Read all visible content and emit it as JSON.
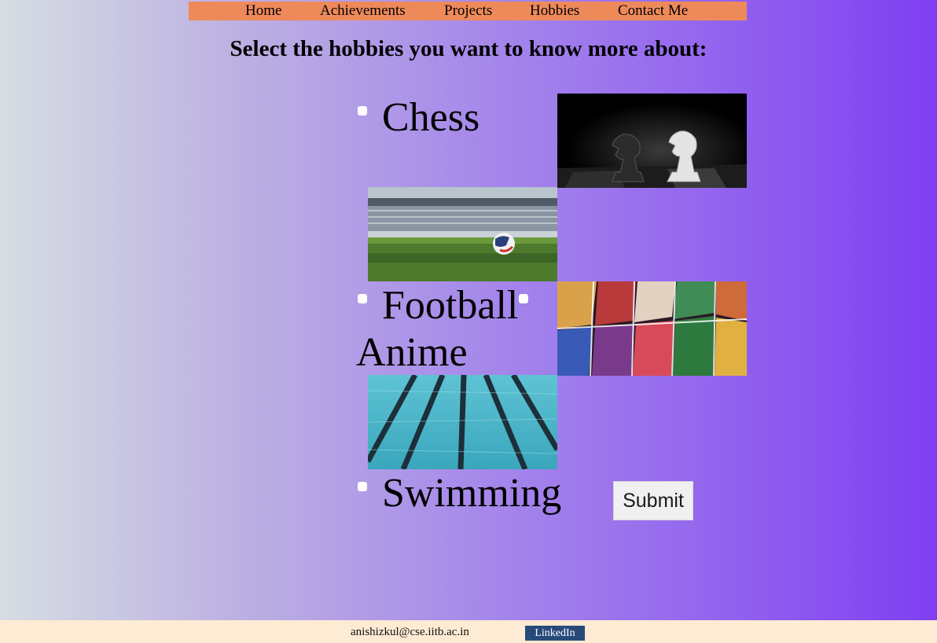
{
  "nav": {
    "items": [
      {
        "label": "Home"
      },
      {
        "label": "Achievements"
      },
      {
        "label": "Projects"
      },
      {
        "label": "Hobbies"
      },
      {
        "label": "Contact Me"
      }
    ],
    "background": "#ee8a5a"
  },
  "page": {
    "heading": "Select the hobbies you want to know more about:"
  },
  "hobbies": [
    {
      "label": "Chess",
      "checked": false,
      "image": "chess-photo"
    },
    {
      "label": "Football",
      "checked": false,
      "image": "football-photo"
    },
    {
      "label": "Anime",
      "checked": false,
      "image": "anime-photo"
    },
    {
      "label": "Swimming",
      "checked": false,
      "image": "swimming-photo"
    }
  ],
  "form": {
    "submit_label": "Submit"
  },
  "footer": {
    "email": "anishizkul@cse.iitb.ac.in",
    "linkedin_label": "LinkedIn",
    "background": "#fdebd3",
    "linkedin_color": "#284a7a"
  }
}
